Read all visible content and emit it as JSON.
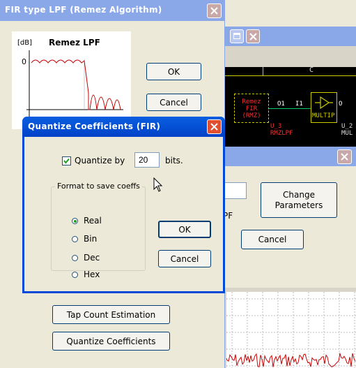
{
  "main_dialog": {
    "title": "FIR type LPF (Remez Algorithm)",
    "chart_title": "Remez LPF",
    "chart_unit": "[dB]",
    "chart_zero": "0",
    "ok_label": "OK",
    "cancel_label": "Cancel",
    "tap_count_label": "Tap Count Estimation",
    "quantize_label": "Quantize Coefficients"
  },
  "quantize_dialog": {
    "title": "Quantize Coefficients (FIR)",
    "quantize_checkbox_label": "Quantize by",
    "quantize_checked": true,
    "bits_value": "20",
    "bits_suffix": "bits.",
    "format_group_label": "Format to save coeffs",
    "formats": [
      "Real",
      "Bin",
      "Dec",
      "Hex"
    ],
    "selected_format": "Real",
    "ok_label": "OK",
    "cancel_label": "Cancel"
  },
  "back_dialog": {
    "change_params_line1": "Change",
    "change_params_line2": "Parameters",
    "cancel_label": "Cancel",
    "partial_text": "PF"
  },
  "schematic": {
    "column_label": "C",
    "block1_line1": "Remez",
    "block1_line2": "FIR",
    "block1_line3": "(RMZ)",
    "port_out": "O1",
    "port_in": "I1",
    "multip_label": "MULTIP",
    "instance_label": "U_3",
    "instance_name": "RMZLPF",
    "right_port": "O",
    "right_instance": "U_2",
    "right_name": "MUL"
  },
  "colors": {
    "titlebar_active": "#0a5ee0",
    "titlebar_inactive": "#8aa8e8",
    "dialog_bg": "#ece9d8",
    "schematic_bg": "#000000",
    "noise_red": "#cc0000"
  }
}
